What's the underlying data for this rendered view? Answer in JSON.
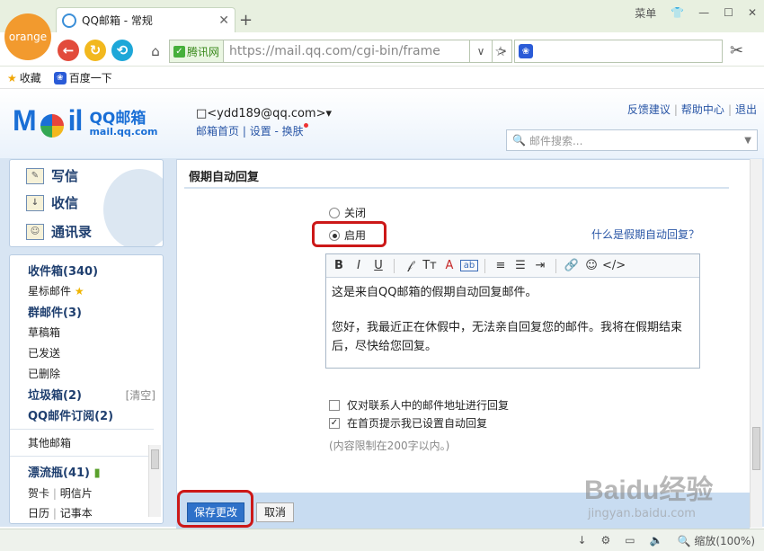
{
  "browser": {
    "logo_text": "orange",
    "tab_title": "QQ邮箱 - 常规",
    "menu_label": "菜单",
    "address_security_label": "腾讯网",
    "address_url": "https://mail.qq.com/cgi-bin/frame",
    "bookmarks": [
      {
        "label": "收藏",
        "icon": "star-icon"
      },
      {
        "label": "百度一下",
        "icon": "paw-icon"
      }
    ]
  },
  "mail_header": {
    "logo_text": "Mail",
    "brand_cn": "QQ邮箱",
    "brand_en": "mail.qq.com",
    "account": "□<ydd189@qq.com>▾",
    "links": [
      "邮箱首页",
      "设置",
      "换肤"
    ],
    "top_links": [
      "反馈建议",
      "帮助中心",
      "退出"
    ],
    "search_placeholder": "邮件搜索..."
  },
  "left_nav": {
    "primary": [
      "写信",
      "收信",
      "通讯录"
    ],
    "folders": [
      {
        "label": "收件箱(340)",
        "bold": true
      },
      {
        "label": "星标邮件",
        "bold": false
      },
      {
        "label": "群邮件(3)",
        "bold": true
      },
      {
        "label": "草稿箱",
        "bold": false
      },
      {
        "label": "已发送",
        "bold": false
      },
      {
        "label": "已删除",
        "bold": false
      },
      {
        "label": "垃圾箱(2)",
        "bold": true
      },
      {
        "label": "QQ邮件订阅(2)",
        "bold": true
      }
    ],
    "clear_label": "[清空]",
    "other_mailbox": "其他邮箱",
    "drift_bottle": "漂流瓶(41)",
    "greeting_card": "贺卡",
    "postcard": "明信片",
    "calendar": "日历",
    "notepad": "记事本"
  },
  "settings": {
    "section_title": "假期自动回复",
    "radio_off": "关闭",
    "radio_on": "启用",
    "selected": "启用",
    "help_link": "什么是假期自动回复？",
    "editor_line1": "这是来自QQ邮箱的假期自动回复邮件。",
    "editor_line2": "您好，我最近正在休假中，无法亲自回复您的邮件。我将在假期结束后，尽快给您回复。",
    "option_contacts_only": "仅对联系人中的邮件地址进行回复",
    "option_contacts_only_checked": false,
    "option_homepage_notice": "在首页提示我已设置自动回复",
    "option_homepage_notice_checked": true,
    "limit_note": "(内容限制在200字以内。)",
    "save_label": "保存更改",
    "cancel_label": "取消"
  },
  "watermark": {
    "big": "Baidu经验",
    "small": "jingyan.baidu.com"
  },
  "status_bar": {
    "zoom": "缩放(100%)"
  },
  "colors": {
    "highlight": "#cc1818",
    "primary_button": "#2e71c9",
    "link": "#2956a6"
  }
}
